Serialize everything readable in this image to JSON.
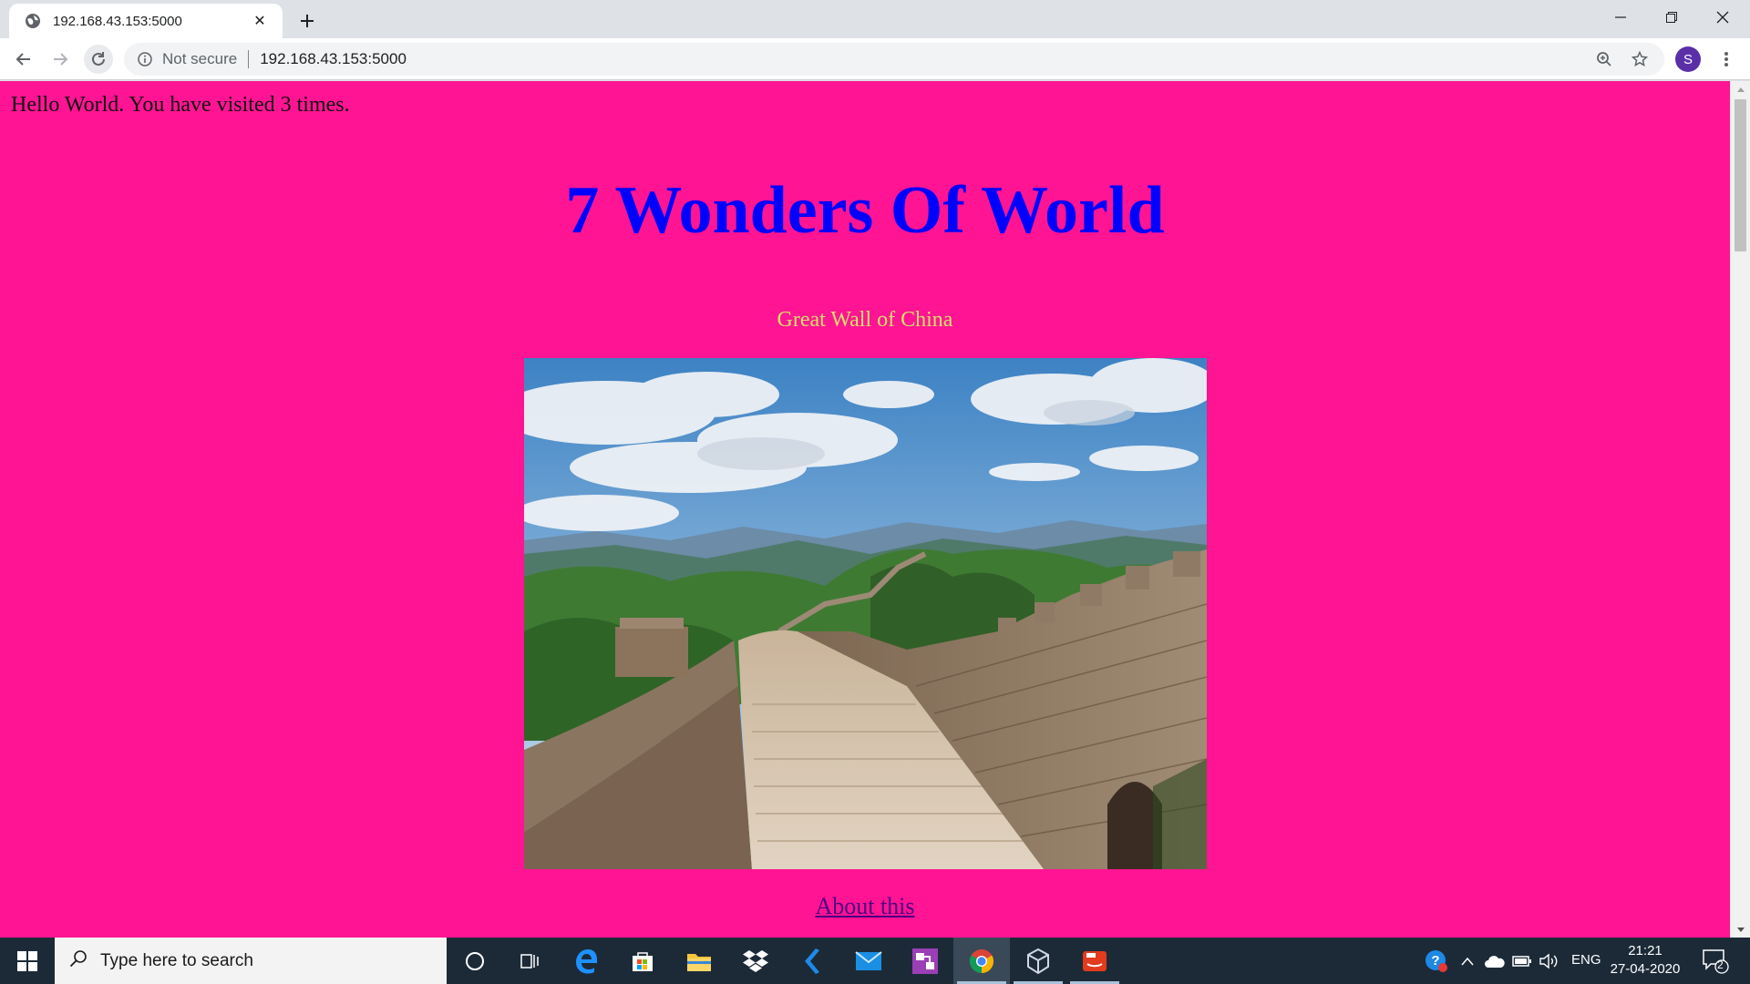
{
  "browser": {
    "tab": {
      "title": "192.168.43.153:5000",
      "close_glyph": "✕"
    },
    "new_tab_glyph": "+",
    "window_controls": {
      "minimize": "–",
      "maximize": "❐",
      "close": "✕"
    },
    "toolbar": {
      "security_label": "Not secure",
      "url": "192.168.43.153:5000",
      "profile_initial": "S"
    }
  },
  "page": {
    "background_color": "#ff1493",
    "greeting": "Hello World. You have visited 3 times.",
    "title": "7 Wonders Of World",
    "wonder_name": "Great Wall of China",
    "link_text": "About this"
  },
  "taskbar": {
    "search_placeholder": "Type here to search",
    "language": "ENG",
    "time": "21:21",
    "date": "27-04-2020",
    "notification_count": "2",
    "apps": [
      "cortana-icon",
      "task-view-icon",
      "edge-icon",
      "store-icon",
      "file-explorer-icon",
      "dropbox-icon",
      "vscode-icon",
      "mail-icon",
      "visual-studio-icon",
      "chrome-icon",
      "virtualbox-icon",
      "java-icon"
    ]
  }
}
